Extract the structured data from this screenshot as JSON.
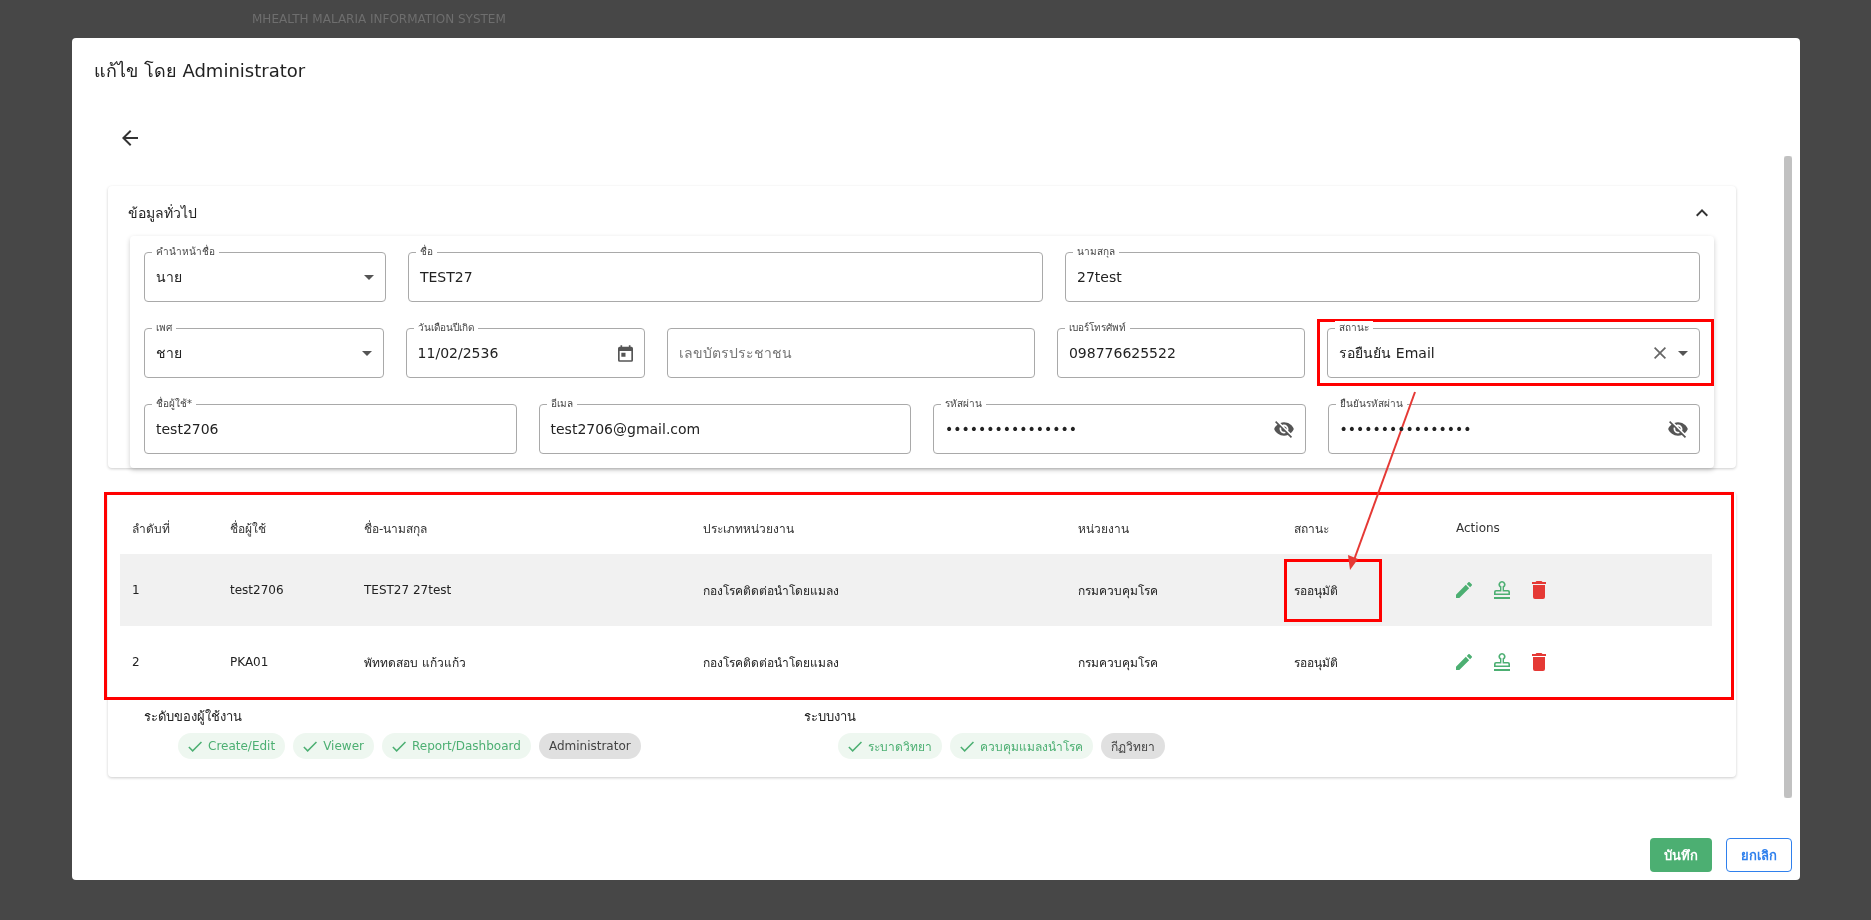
{
  "backdrop": {
    "app_title": "MHEALTH MALARIA INFORMATION SYSTEM"
  },
  "dialog": {
    "title": "แก้ไข โดย Administrator"
  },
  "section": {
    "title": "ข้อมูลทั่วไป",
    "expanded": true
  },
  "field_rows": [
    [
      {
        "kind": "select",
        "label": "คำนำหน้าชื่อ",
        "value": "นาย"
      },
      {
        "kind": "text",
        "label": "ชื่อ",
        "value": "TEST27"
      },
      {
        "kind": "text",
        "label": "นามสกุล",
        "value": "27test"
      }
    ],
    [
      {
        "kind": "select",
        "label": "เพศ",
        "value": "ชาย"
      },
      {
        "kind": "date",
        "label": "วันเดือนปีเกิด",
        "value": "11/02/2536"
      },
      {
        "kind": "text",
        "placeholder": "เลขบัตรประชาชน"
      },
      {
        "kind": "text",
        "label": "เบอร์โทรศัพท์",
        "value": "098776625522"
      },
      {
        "kind": "select",
        "label": "สถานะ",
        "value": "รอยืนยัน Email",
        "clearable": true,
        "highlighted": true
      }
    ],
    [
      {
        "kind": "text",
        "label": "ชื่อผู้ใช้*",
        "value": "test2706"
      },
      {
        "kind": "text",
        "label": "อีเมล",
        "value": "test2706@gmail.com"
      },
      {
        "kind": "password",
        "label": "รหัสผ่าน",
        "value": "••••••••••••••••"
      },
      {
        "kind": "password",
        "label": "ยืนยันรหัสผ่าน",
        "value": "••••••••••••••••"
      }
    ]
  ],
  "table": {
    "highlighted": true,
    "columns": [
      "ลำดับที่",
      "ชื่อผู้ใช้",
      "ชื่อ-นามสกุล",
      "ประเภทหน่วยงาน",
      "หน่วยงาน",
      "สถานะ",
      "Actions"
    ],
    "rows": [
      {
        "cells": [
          "1",
          "test2706",
          "TEST27 27test",
          "กองโรคติดต่อนำโดยแมลง",
          "กรมควบคุมโรค",
          "รออนุมัติ"
        ],
        "selected": true,
        "status_highlighted": true
      },
      {
        "cells": [
          "2",
          "PKA01",
          "พัททดสอบ แก้วแก้ว",
          "กองโรคติดต่อนำโดยแมลง",
          "กรมควบคุมโรค",
          "รออนุมัติ"
        ],
        "selected": false,
        "status_highlighted": false
      }
    ]
  },
  "chip_groups": [
    {
      "label": "ระดับของผู้ใช้งาน",
      "items": [
        {
          "label": "Create/Edit",
          "checked": true
        },
        {
          "label": "Viewer",
          "checked": true
        },
        {
          "label": "Report/Dashboard",
          "checked": true
        },
        {
          "label": "Administrator",
          "checked": false
        }
      ]
    },
    {
      "label": "ระบบงาน",
      "items": [
        {
          "label": "ระบาดวิทยา",
          "checked": true
        },
        {
          "label": "ควบคุมแมลงนำโรค",
          "checked": true
        },
        {
          "label": "กีฏวิทยา",
          "checked": false
        }
      ]
    }
  ],
  "buttons": [
    {
      "label": "บันทึก",
      "kind": "primary"
    },
    {
      "label": "ยกเลิก",
      "kind": "outline"
    }
  ]
}
